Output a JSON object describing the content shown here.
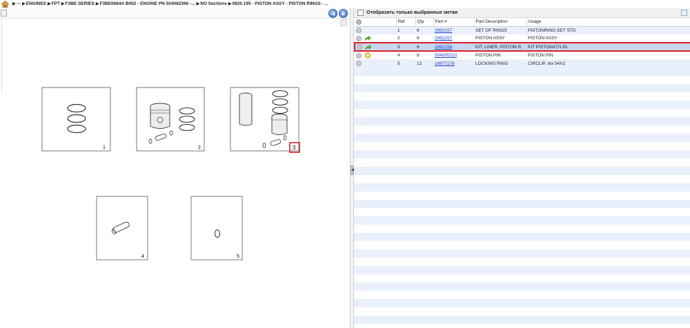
{
  "breadcrumb": {
    "items": [
      "---",
      "ENGINES",
      "FPT",
      "F3BE SERIES",
      "F3BE0684A B002 - ENGINE PN 504082366 -...",
      "NO Sections",
      "0820.195 - PISTON ASSY - PISTON RINGS - ..."
    ]
  },
  "drawing": {
    "callouts": [
      "1",
      "2",
      "3",
      "4",
      "5"
    ],
    "highlighted_callout": "3"
  },
  "right_panel": {
    "filter_label": "Отобразить только выбранные метки",
    "columns": [
      "",
      "Ref",
      "Qty",
      "Part #",
      "Part Description",
      "Usage"
    ],
    "rows": [
      {
        "ref": "1",
        "qty": "6",
        "part": "2992157",
        "desc": "SET OF RINGS",
        "usage": "PISTONRING SET STD",
        "icon": ""
      },
      {
        "ref": "2",
        "qty": "6",
        "part": "2992257",
        "desc": "PISTON ASSY",
        "usage": "PISTON ASSY",
        "icon": "green-arrow-icon"
      },
      {
        "ref": "3",
        "qty": "6",
        "part": "2992258",
        "desc": "KIT, LINER, PISTON R",
        "usage": "KIT PISTON/CYLIN.",
        "icon": "green-arrow-icon",
        "selected": true
      },
      {
        "ref": "4",
        "qty": "6",
        "part": "504005110",
        "desc": "PISTON PIN",
        "usage": "PISTON PIN",
        "icon": "yellow-note-icon"
      },
      {
        "ref": "5",
        "qty": "12",
        "part": "16877276",
        "desc": "LOCKING RING",
        "usage": "CIRCLIP, dia 54X2",
        "icon": ""
      }
    ]
  },
  "colors": {
    "highlight_red": "#d61f26",
    "link_blue": "#1a3ccf",
    "stripe_blue": "#e9f0fb",
    "selected_row": "#c8d7ee"
  }
}
